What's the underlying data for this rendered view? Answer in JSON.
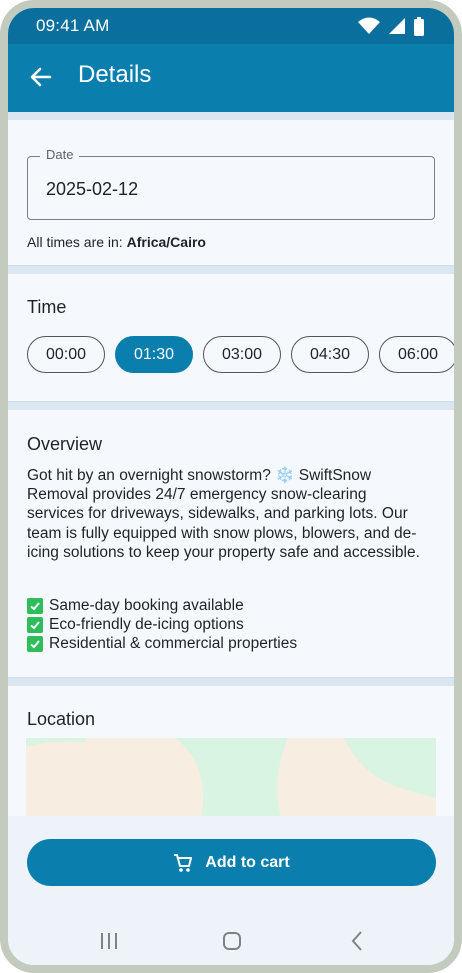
{
  "status_bar": {
    "time": "09:41 AM"
  },
  "app_bar": {
    "title": "Details"
  },
  "date": {
    "label": "Date",
    "value": "2025-02-12",
    "timezone_prefix": "All times are in:",
    "timezone": "Africa/Cairo"
  },
  "time": {
    "title": "Time",
    "slots": [
      "00:00",
      "01:30",
      "03:00",
      "04:30",
      "06:00"
    ],
    "selected": "01:30"
  },
  "overview": {
    "title": "Overview",
    "text": "Got hit by an overnight snowstorm? ❄️ SwiftSnow Removal provides 24/7 emergency snow-clearing services for driveways, sidewalks, and parking lots. Our team is fully equipped with snow plows, blowers, and de-icing solutions to keep your property safe and accessible.",
    "features": [
      "Same-day booking available",
      "Eco-friendly de-icing options",
      "Residential & commercial properties"
    ]
  },
  "location": {
    "title": "Location"
  },
  "actions": {
    "add_to_cart": "Add to cart"
  },
  "colors": {
    "primary": "#0a7fae",
    "status_bar": "#0a6f9c",
    "background": "#eef3fa",
    "check": "#2ebd5a"
  }
}
